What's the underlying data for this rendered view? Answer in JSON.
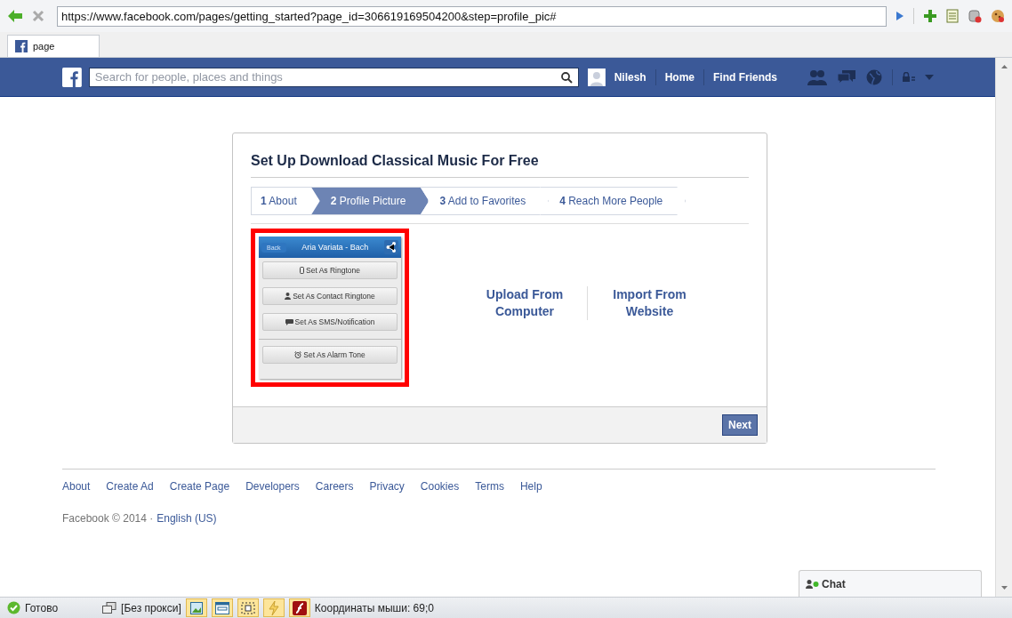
{
  "browser": {
    "url": "https://www.facebook.com/pages/getting_started?page_id=306619169504200&step=profile_pic#",
    "tab": {
      "title": "page"
    }
  },
  "header": {
    "search_placeholder": "Search for people, places and things",
    "user": "Nilesh",
    "nav": [
      "Home",
      "Find Friends"
    ]
  },
  "dialog": {
    "title": "Set Up Download Classical Music For Free",
    "steps": [
      {
        "number": "1",
        "label": "About",
        "selected": false
      },
      {
        "number": "2",
        "label": "Profile Picture",
        "selected": true
      },
      {
        "number": "3",
        "label": "Add to Favorites",
        "selected": false
      },
      {
        "number": "4",
        "label": "Reach More People",
        "selected": false
      }
    ],
    "preview": {
      "back": "Back",
      "title": "Aria Variata - Bach",
      "action_groups": [
        [
          {
            "label": "Set As Ringtone",
            "kind": "phone"
          },
          {
            "label": "Set As Contact Ringtone",
            "kind": "person"
          },
          {
            "label": "Set As SMS/Notification",
            "kind": "speech"
          }
        ],
        [
          {
            "label": "Set As Alarm Tone",
            "kind": "alarm"
          }
        ]
      ]
    },
    "options": [
      "Upload From Computer",
      "Import From Website"
    ],
    "next": "Next"
  },
  "footer": {
    "links": [
      "About",
      "Create Ad",
      "Create Page",
      "Developers",
      "Careers",
      "Privacy",
      "Cookies",
      "Terms",
      "Help"
    ],
    "copyright": "Facebook © 2014 ·",
    "language": "English (US)"
  },
  "chat": "Chat",
  "status_bar": {
    "status": "Готово",
    "proxy": "[Без прокси]",
    "coords": "Координаты мыши: 69;0"
  }
}
